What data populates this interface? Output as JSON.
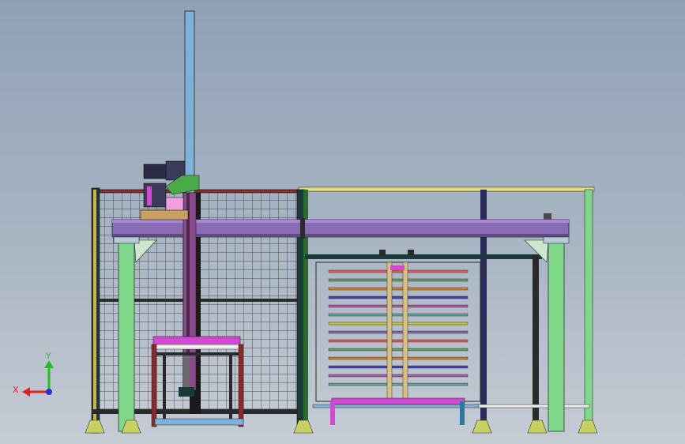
{
  "view": {
    "triad": {
      "x_label": "X",
      "y_label": "Y",
      "x_color": "#e02020",
      "y_color": "#20c020",
      "z_color": "#2030d0"
    }
  },
  "colors": {
    "background_top": "#8fa0b6",
    "background_bottom": "#c5ccd4",
    "mast": "#7fb0d8",
    "cross_beam": "#8a6bb5",
    "column": "#7fd88a",
    "fence_frame_left": "#8b2a2a",
    "fence_frame_right": "#e8e070",
    "mesh": "#2a2a2a",
    "motor": "#2a2a44",
    "gearbox": "#4aaa4a",
    "carriage": "#d24ad2",
    "foot": "#c8d060",
    "post_dark": "#1a3a3a",
    "rack_rail": "#d8c080",
    "tray_colors": [
      "#d06060",
      "#60a060",
      "#c08040",
      "#4040c0",
      "#a060a0",
      "#60a0a0",
      "#c0c040",
      "#8060c0"
    ]
  }
}
